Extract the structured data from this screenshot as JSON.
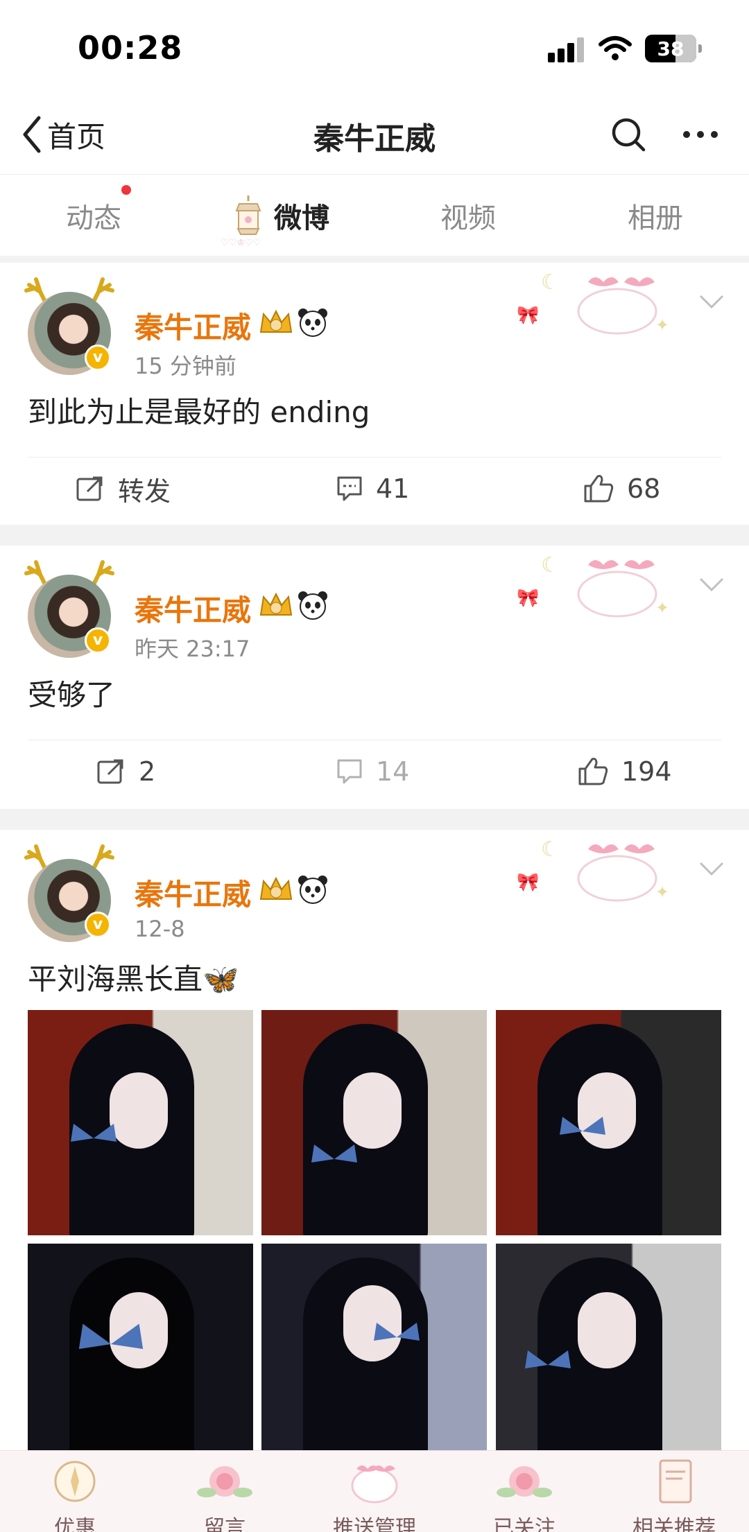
{
  "status_bar": {
    "time": "00:28",
    "battery": "38"
  },
  "nav": {
    "back_label": "首页",
    "title": "秦牛正威"
  },
  "tabs": [
    {
      "label": "动态",
      "has_dot": true
    },
    {
      "label": "微博",
      "active": true
    },
    {
      "label": "视频"
    },
    {
      "label": "相册"
    }
  ],
  "posts": [
    {
      "username": "秦牛正威",
      "time": "15 分钟前",
      "text": "到此为止是最好的 ending",
      "repost": "转发",
      "comments": "41",
      "likes": "68"
    },
    {
      "username": "秦牛正威",
      "time": "昨天 23:17",
      "text": "受够了",
      "repost": "2",
      "comments": "14",
      "likes": "194"
    },
    {
      "username": "秦牛正威",
      "time": "12-8",
      "text": "平刘海黑长直🦋",
      "photo_count": 6
    }
  ],
  "bottom_bar": [
    {
      "label": "优惠"
    },
    {
      "label": "留言"
    },
    {
      "label": "推送管理"
    },
    {
      "label": "已关注"
    },
    {
      "label": "相关推荐"
    }
  ],
  "colors": {
    "username": "#e8760c",
    "verified": "#f5b400",
    "notify_dot": "#f0343c"
  }
}
